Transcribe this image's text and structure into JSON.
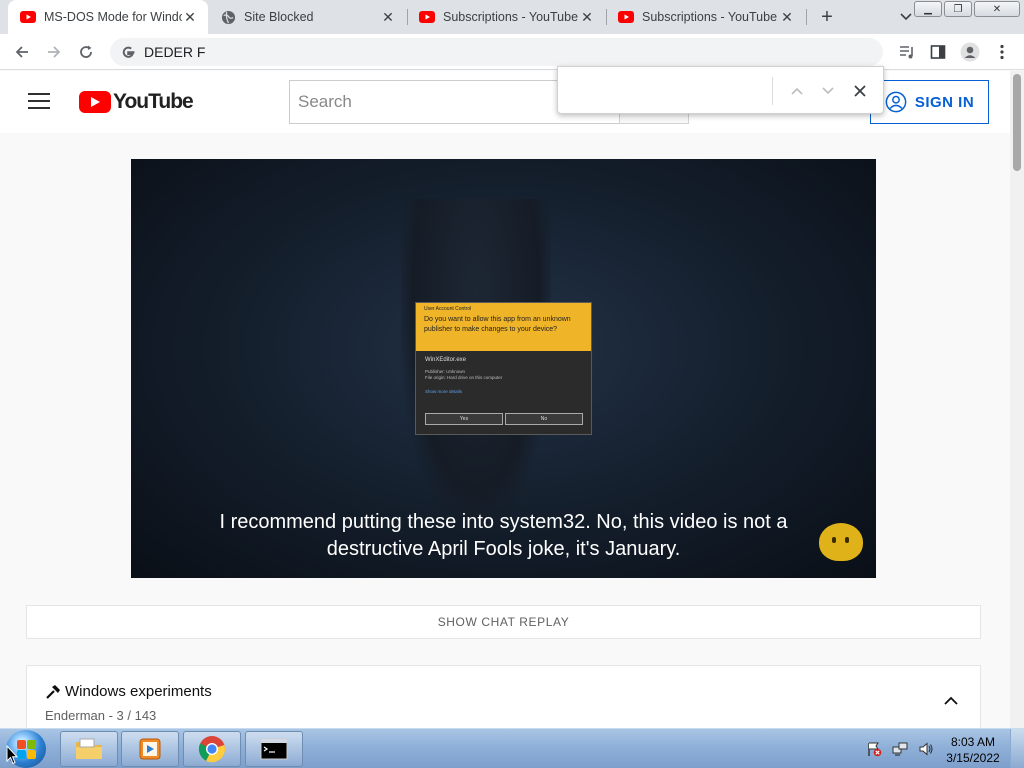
{
  "browser": {
    "tabs": [
      {
        "title": "MS-DOS Mode for Windows",
        "icon": "youtube-icon",
        "active": true
      },
      {
        "title": "Site Blocked",
        "icon": "globe-icon",
        "active": false
      },
      {
        "title": "Subscriptions - YouTube",
        "icon": "youtube-icon",
        "active": false
      },
      {
        "title": "Subscriptions - YouTube",
        "icon": "youtube-icon",
        "active": false
      }
    ],
    "address": "DEDER F",
    "find_query": ""
  },
  "youtube": {
    "logo_text": "YouTube",
    "search_placeholder": "Search",
    "signin_label": "SIGN IN"
  },
  "video": {
    "uac": {
      "header": "User Account Control",
      "question": "Do you want to allow this app from an unknown publisher to make changes to your device?",
      "app_name": "WinXEditor.exe",
      "publisher": "Publisher: Unknown",
      "origin": "File origin: Hard drive on this computer",
      "link": "Show more details",
      "yes": "Yes",
      "no": "No"
    },
    "subtitle_line1": "I recommend putting these into system32. No, this video is not a",
    "subtitle_line2": "destructive April Fools joke, it's January."
  },
  "chat": {
    "label": "SHOW CHAT REPLAY"
  },
  "playlist": {
    "title": "Windows experiments",
    "subtitle": "Enderman - 3 / 143"
  },
  "taskbar": {
    "time": "8:03 AM",
    "date": "3/15/2022"
  },
  "colors": {
    "yt_red": "#ff0000",
    "link_blue": "#065fd4",
    "uac_yellow": "#f0b429"
  }
}
